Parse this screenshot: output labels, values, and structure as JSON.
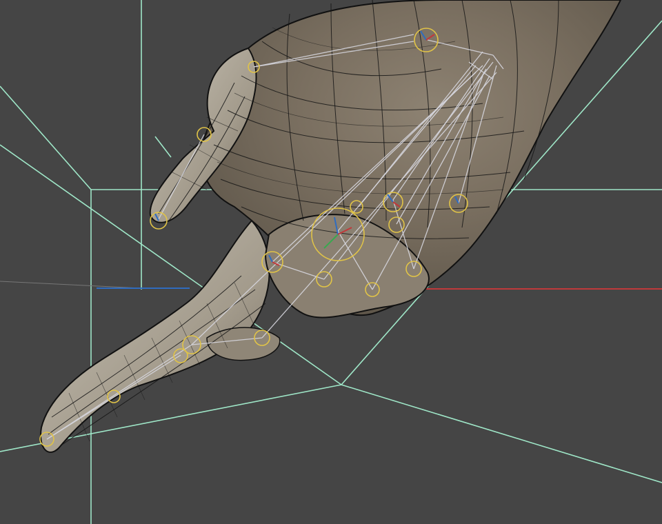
{
  "viewport": {
    "background": "#454545",
    "axes": {
      "x_color": "#c0393b",
      "z_color": "#2f6cc0"
    },
    "guide_color": "#9fe7c8",
    "joint_color": "#e1c447",
    "bone_color": "#d6d6de",
    "mesh_color": "#b9b2a4"
  },
  "icons": [
    "hand-mesh-icon",
    "bone-chain-icon",
    "joint-gizmo-icon"
  ]
}
